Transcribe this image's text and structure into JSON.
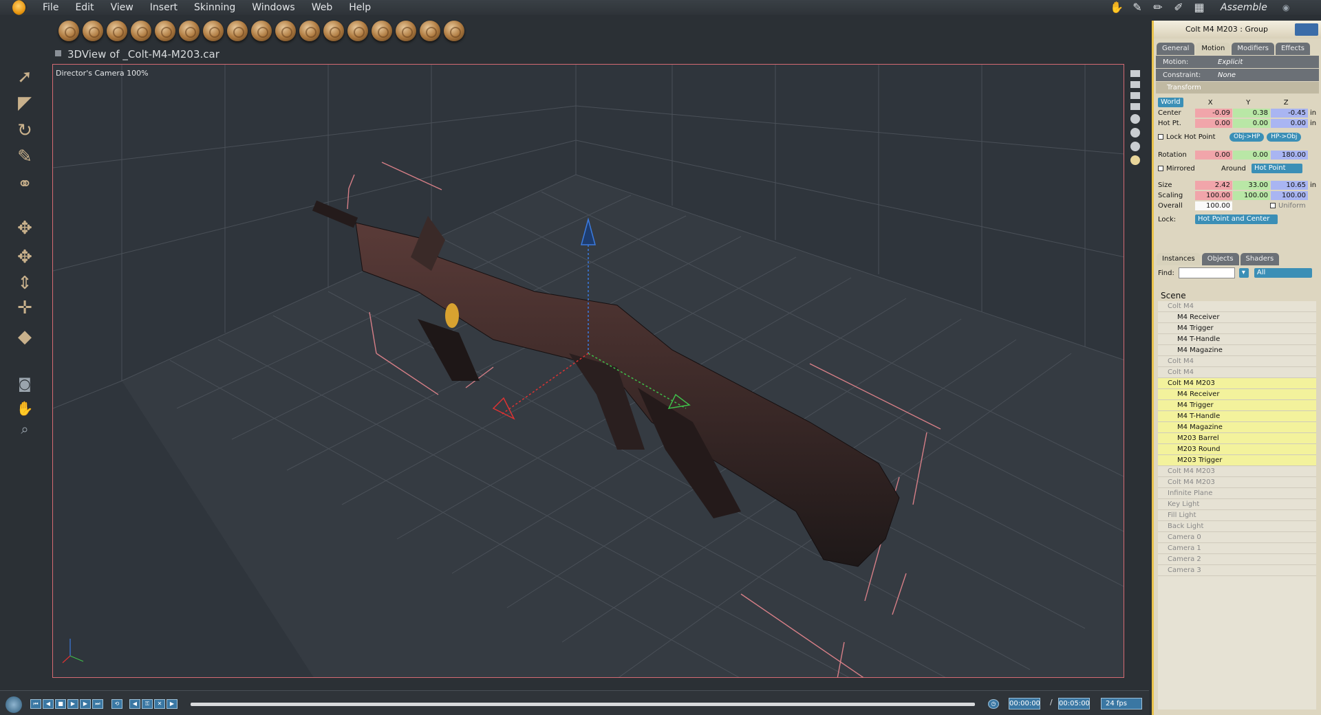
{
  "menubar": {
    "items": [
      "File",
      "Edit",
      "View",
      "Insert",
      "Skinning",
      "Windows",
      "Web",
      "Help"
    ]
  },
  "room": {
    "label": "Assemble"
  },
  "document": {
    "title": "3DView of _Colt-M4-M203.car",
    "camera_label": "Director's Camera 100%"
  },
  "panel": {
    "selection_title": "Colt M4 M203 : Group",
    "tabs": [
      "General",
      "Motion",
      "Modifiers",
      "Effects"
    ],
    "active_tab": "Motion",
    "motion": {
      "label": "Motion:",
      "value": "Explicit"
    },
    "constraint": {
      "label": "Constraint:",
      "value": "None"
    },
    "transform_label": "Transform",
    "space": "World",
    "axes": [
      "X",
      "Y",
      "Z"
    ],
    "center": {
      "label": "Center",
      "x": "-0.09",
      "y": "0.38",
      "z": "-0.45",
      "unit": "in"
    },
    "hotpoint": {
      "label": "Hot Pt.",
      "x": "0.00",
      "y": "0.00",
      "z": "0.00",
      "unit": "in"
    },
    "lock_hot_point": "Lock Hot Point",
    "obj_hp": "Obj->HP",
    "hp_obj": "HP->Obj",
    "rotation": {
      "label": "Rotation",
      "x": "0.00",
      "y": "0.00",
      "z": "180.00"
    },
    "mirrored": "Mirrored",
    "around_label": "Around",
    "around_value": "Hot Point",
    "size": {
      "label": "Size",
      "x": "2.42",
      "y": "33.00",
      "z": "10.65",
      "unit": "in"
    },
    "scaling": {
      "label": "Scaling",
      "x": "100.00",
      "y": "100.00",
      "z": "100.00"
    },
    "overall": {
      "label": "Overall",
      "value": "100.00",
      "uniform": "Uniform"
    },
    "lock": {
      "label": "Lock:",
      "value": "Hot Point and Center"
    }
  },
  "instances": {
    "tabs": [
      "Instances",
      "Objects",
      "Shaders"
    ],
    "find_label": "Find:",
    "filter": "All",
    "scene_label": "Scene",
    "rows": [
      {
        "label": "Colt M4",
        "type": "group"
      },
      {
        "label": "M4 Receiver",
        "type": "child"
      },
      {
        "label": "M4 Trigger",
        "type": "child"
      },
      {
        "label": "M4 T-Handle",
        "type": "child"
      },
      {
        "label": "M4 Magazine",
        "type": "child"
      },
      {
        "label": "Colt M4",
        "type": "group"
      },
      {
        "label": "Colt M4",
        "type": "group"
      },
      {
        "label": "Colt M4 M203",
        "type": "selected"
      },
      {
        "label": "M4 Receiver",
        "type": "selchild"
      },
      {
        "label": "M4 Trigger",
        "type": "selchild"
      },
      {
        "label": "M4 T-Handle",
        "type": "selchild"
      },
      {
        "label": "M4 Magazine",
        "type": "selchild"
      },
      {
        "label": "M203 Barrel",
        "type": "selchild"
      },
      {
        "label": "M203 Round",
        "type": "selchild"
      },
      {
        "label": "M203 Trigger",
        "type": "selchild"
      },
      {
        "label": "Colt M4 M203",
        "type": "group"
      },
      {
        "label": "Colt M4 M203",
        "type": "group"
      },
      {
        "label": "Infinite Plane",
        "type": "group"
      },
      {
        "label": "Key Light",
        "type": "group"
      },
      {
        "label": "Fill Light",
        "type": "group"
      },
      {
        "label": "Back Light",
        "type": "group"
      },
      {
        "label": "Camera 0",
        "type": "group"
      },
      {
        "label": "Camera 1",
        "type": "group"
      },
      {
        "label": "Camera 2",
        "type": "group"
      },
      {
        "label": "Camera 3",
        "type": "group"
      }
    ]
  },
  "timeline": {
    "current": "00:00:00",
    "slash": "/",
    "end": "00:05:00",
    "fps": "24 fps"
  },
  "colors": {
    "accent": "#e9c34c",
    "selection": "#f3f29c",
    "viewport_border": "#d66b73",
    "button_blue": "#3b8fb6"
  }
}
